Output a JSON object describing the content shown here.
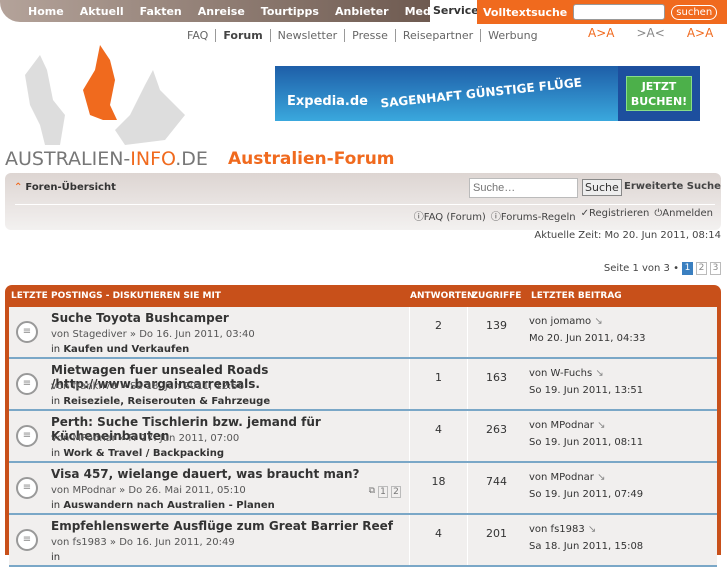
{
  "topnav": {
    "items": [
      "Home",
      "Aktuell",
      "Fakten",
      "Anreise",
      "Tourtipps",
      "Anbieter",
      "Medien"
    ],
    "service": "Service",
    "search_label": "Volltextsuche",
    "search_button": "suchen",
    "search_value": ""
  },
  "subnav": {
    "items": [
      "FAQ",
      "Forum",
      "Newsletter",
      "Presse",
      "Reisepartner",
      "Werbung"
    ],
    "font_controls": [
      "A>A",
      ">A<",
      "A>A"
    ]
  },
  "header": {
    "logo_part1": "AUSTRALIEN-",
    "logo_part2": "INFO",
    "logo_part3": ".DE",
    "forum_title": "Australien-Forum"
  },
  "ad": {
    "brand": "Expedia.de",
    "slogan": "SAGENHAFT GÜNSTIGE FLÜGE",
    "cta_line1": "JETZT",
    "cta_line2": "BUCHEN!"
  },
  "navbar": {
    "home": "Foren-Übersicht",
    "search_placeholder": "Suche…",
    "search_button": "Suche",
    "advanced": "Erweiterte Suche",
    "links": [
      "FAQ (Forum)",
      "Forums-Regeln",
      "Registrieren",
      "Anmelden"
    ]
  },
  "time": "Aktuelle Zeit: Mo 20. Jun 2011, 08:14",
  "pagination": {
    "label": "Seite 1 von 3 •",
    "pages": [
      "1",
      "2",
      "3"
    ],
    "current": 1
  },
  "board": {
    "headers": [
      "LETZTE POSTINGS - DISKUTIEREN SIE MIT",
      "ANTWORTEN",
      "ZUGRIFFE",
      "LETZTER BEITRAG"
    ],
    "topics": [
      {
        "title": "Suche Toyota Bushcamper",
        "by": "von Stagediver » Do 16. Jun 2011, 03:40",
        "in": "in",
        "forum": "Kaufen und Verkaufen",
        "replies": "2",
        "views": "139",
        "last_by": "von jomamo",
        "last_time": "Mo 20. Jun 2011, 04:33"
      },
      {
        "title": "Mietwagen fuer unsealed Roads /http://www.bargaincarrentals.",
        "by": "von frankn70 » Sa 18. Jun 2011, 12:56",
        "in": "in",
        "forum": "Reiseziele, Reiserouten & Fahrzeuge",
        "replies": "1",
        "views": "163",
        "last_by": "von W-Fuchs",
        "last_time": "So 19. Jun 2011, 13:51"
      },
      {
        "title": "Perth: Suche Tischlerin bzw. jemand für Kücheneinbauten",
        "by": "von MPodnar » Fr 17. Jun 2011, 07:00",
        "in": "in",
        "forum": "Work & Travel / Backpacking",
        "replies": "4",
        "views": "263",
        "last_by": "von MPodnar",
        "last_time": "So 19. Jun 2011, 08:11"
      },
      {
        "title": "Visa 457, wielange dauert, was braucht man?",
        "by": "von MPodnar » Do 26. Mai 2011, 05:10",
        "in": "in",
        "forum": "Auswandern nach Australien - Planen",
        "replies": "18",
        "views": "744",
        "last_by": "von MPodnar",
        "last_time": "So 19. Jun 2011, 07:49",
        "pages": [
          "1",
          "2"
        ]
      },
      {
        "title": "Empfehlenswerte Ausflüge zum Great Barrier Reef",
        "by": "von fs1983 » Do 16. Jun 2011, 20:49",
        "in": "in",
        "forum": "",
        "replies": "4",
        "views": "201",
        "last_by": "von fs1983",
        "last_time": "Sa 18. Jun 2011, 15:08"
      }
    ]
  },
  "colors": {
    "accent": "#f06a1e",
    "board": "#c8501a",
    "row_border": "#7aa7c7"
  }
}
